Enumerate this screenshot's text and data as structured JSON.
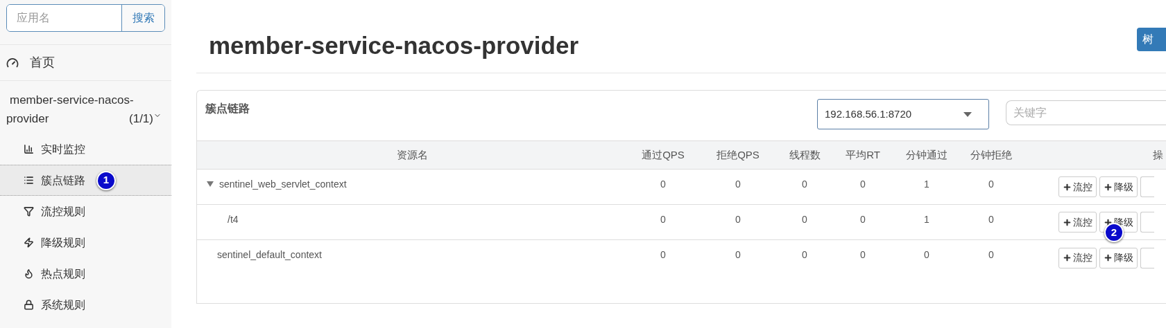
{
  "sidebar": {
    "search": {
      "placeholder": "应用名",
      "button": "搜索"
    },
    "home": {
      "label": "首页"
    },
    "app": {
      "name": "member-service-nacos-provider",
      "count": "(1/1)",
      "expanded": true
    },
    "items": [
      {
        "label": "实时监控",
        "selected": false
      },
      {
        "label": "簇点链路",
        "selected": true,
        "marker": "1"
      },
      {
        "label": "流控规则",
        "selected": false
      },
      {
        "label": "降级规则",
        "selected": false
      },
      {
        "label": "热点规则",
        "selected": false
      },
      {
        "label": "系统规则",
        "selected": false
      }
    ]
  },
  "page": {
    "title": "member-service-nacos-provider",
    "top_button": "树"
  },
  "panel": {
    "title": "簇点链路",
    "machine": "192.168.56.1:8720",
    "keyword_placeholder": "关键字",
    "columns": [
      "资源名",
      "通过QPS",
      "拒绝QPS",
      "线程数",
      "平均RT",
      "分钟通过",
      "分钟拒绝",
      "操"
    ],
    "rows": [
      {
        "name": "sentinel_web_servlet_context",
        "expanded": true,
        "values": [
          "0",
          "0",
          "0",
          "0",
          "1",
          "0"
        ],
        "actions": [
          "流控",
          "降级"
        ],
        "children": [
          {
            "name": "/t4",
            "values": [
              "0",
              "0",
              "0",
              "0",
              "1",
              "0"
            ],
            "actions": [
              "流控",
              "降级"
            ],
            "marker": "2"
          }
        ]
      },
      {
        "name": "sentinel_default_context",
        "values": [
          "0",
          "0",
          "0",
          "0",
          "0",
          "0"
        ],
        "actions": [
          "流控",
          "降级"
        ]
      }
    ]
  }
}
